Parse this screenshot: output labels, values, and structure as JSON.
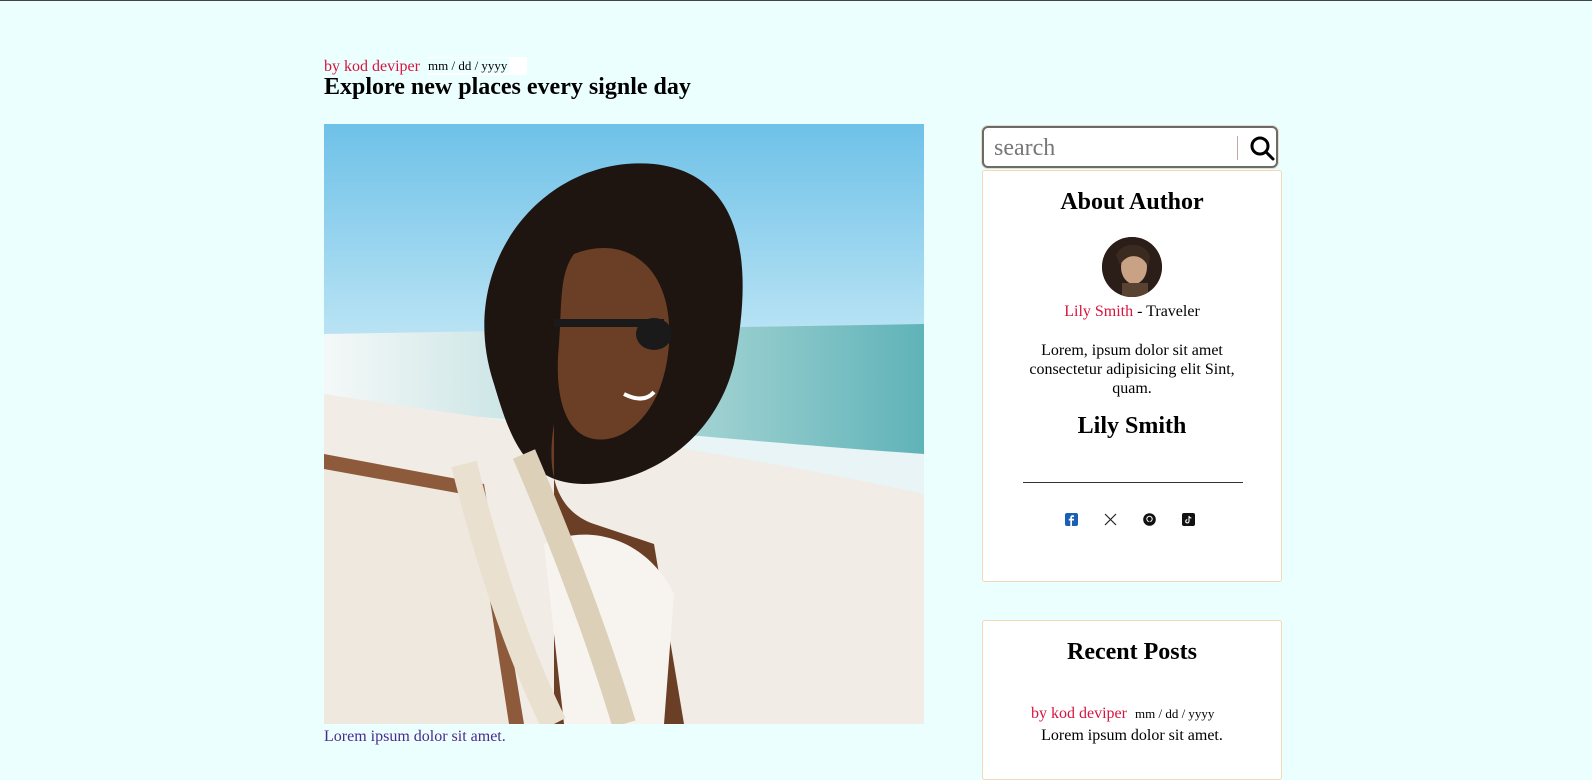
{
  "post": {
    "author": "by kod deviper",
    "date_placeholder": "mm / dd / yyyy",
    "title": "Explore new places every signle day",
    "caption": "Lorem ipsum dolor sit amet."
  },
  "search": {
    "placeholder": "search"
  },
  "about": {
    "heading": "About Author",
    "name": "Lily Smith",
    "role": "- Traveler",
    "bio": "Lorem, ipsum dolor sit amet consectetur adipisicing elit Sint, quam.",
    "signature": "Lily Smith",
    "socials": [
      "facebook-icon",
      "x-icon",
      "github-icon",
      "tiktok-icon"
    ]
  },
  "recent": {
    "heading": "Recent Posts",
    "items": [
      {
        "author": "by kod deviper",
        "date": "mm / dd / yyyy",
        "title": "Lorem ipsum dolor sit amet."
      }
    ]
  },
  "colors": {
    "background": "#ecffff",
    "accent": "#d7143f",
    "caption": "#4b2a8c",
    "card_border": "#f0d9b5"
  }
}
